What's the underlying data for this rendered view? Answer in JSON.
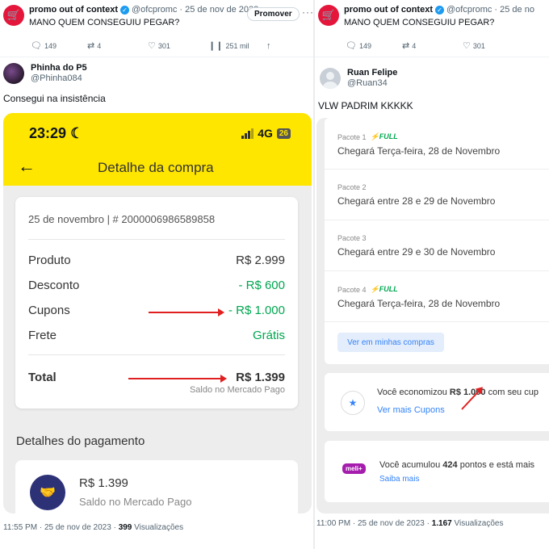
{
  "left": {
    "tweet": {
      "name": "promo out of context",
      "handle": "@ofcpromc",
      "date": "· 25 de nov de 2023",
      "promote_label": "Promover",
      "text": "MANO QUEM CONSEGUIU PEGAR?",
      "replies": "149",
      "retweets": "4",
      "likes": "301",
      "views": "251 mil"
    },
    "reply": {
      "name": "Phinha do P5",
      "handle": "@Phinha084",
      "text": "Consegui na insistência"
    },
    "phone": {
      "time": "23:29",
      "network": "4G",
      "battery": "26",
      "title": "Detalhe da compra",
      "order_header": "25 de novembro  |  # 2000006986589858",
      "rows": [
        {
          "label": "Produto",
          "value": "R$ 2.999"
        },
        {
          "label": "Desconto",
          "value": "- R$ 600"
        },
        {
          "label": "Cupons",
          "value": "- R$ 1.000"
        },
        {
          "label": "Frete",
          "value": "Grátis"
        }
      ],
      "total_label": "Total",
      "total_value": "R$ 1.399",
      "total_sub": "Saldo no Mercado Pago",
      "payment_title": "Detalhes do pagamento",
      "payment_amount": "R$ 1.399",
      "payment_sub": "Saldo no Mercado Pago"
    },
    "footer": {
      "time": "11:55 PM · 25 de nov de 2023 · ",
      "views": "399",
      "views_label": " Visualizações"
    }
  },
  "right": {
    "tweet": {
      "name": "promo out of context",
      "handle": "@ofcpromc",
      "date": "· 25 de no",
      "text": "MANO QUEM CONSEGUIU PEGAR?",
      "replies": "149",
      "retweets": "4",
      "likes": "301"
    },
    "reply": {
      "name": "Ruan Felipe",
      "handle": "@Ruan34",
      "text": "VLW PADRIM KKKKK"
    },
    "packages": [
      {
        "label": "Pacote 1",
        "full": "FULL",
        "date": "Chegará Terça-feira, 28 de Novembro"
      },
      {
        "label": "Pacote 2",
        "full": "",
        "date": "Chegará entre 28 e 29 de Novembro"
      },
      {
        "label": "Pacote 3",
        "full": "",
        "date": "Chegará entre 29 e 30 de Novembro"
      },
      {
        "label": "Pacote 4",
        "full": "FULL",
        "date": "Chegará Terça-feira, 28 de Novembro"
      }
    ],
    "purchases_button": "Ver em minhas compras",
    "savings": {
      "prefix": "Você economizou ",
      "amount": "R$ 1.000",
      "suffix": " com seu cup",
      "link": "Ver mais Cupons"
    },
    "meli": {
      "badge": "meli+",
      "prefix": "Você acumulou ",
      "points": "424",
      "suffix": " pontos e está mais",
      "link": "Saiba mais"
    },
    "footer": {
      "time": "11:00 PM · 25 de nov de 2023 · ",
      "views": "1.167",
      "views_label": " Visualizações"
    }
  },
  "colors": {
    "accent_yellow": "#ffe600",
    "green": "#00a650",
    "blue_link": "#3483fa",
    "arrow_red": "#e02020",
    "brand_red": "#e4163b"
  },
  "icons": [
    "store-logo-icon",
    "verified-icon",
    "reply-icon",
    "retweet-icon",
    "like-icon",
    "views-icon",
    "share-icon",
    "back-arrow-icon",
    "moon-icon",
    "signal-icon",
    "handshake-icon",
    "bolt-icon",
    "coupon-icon"
  ]
}
